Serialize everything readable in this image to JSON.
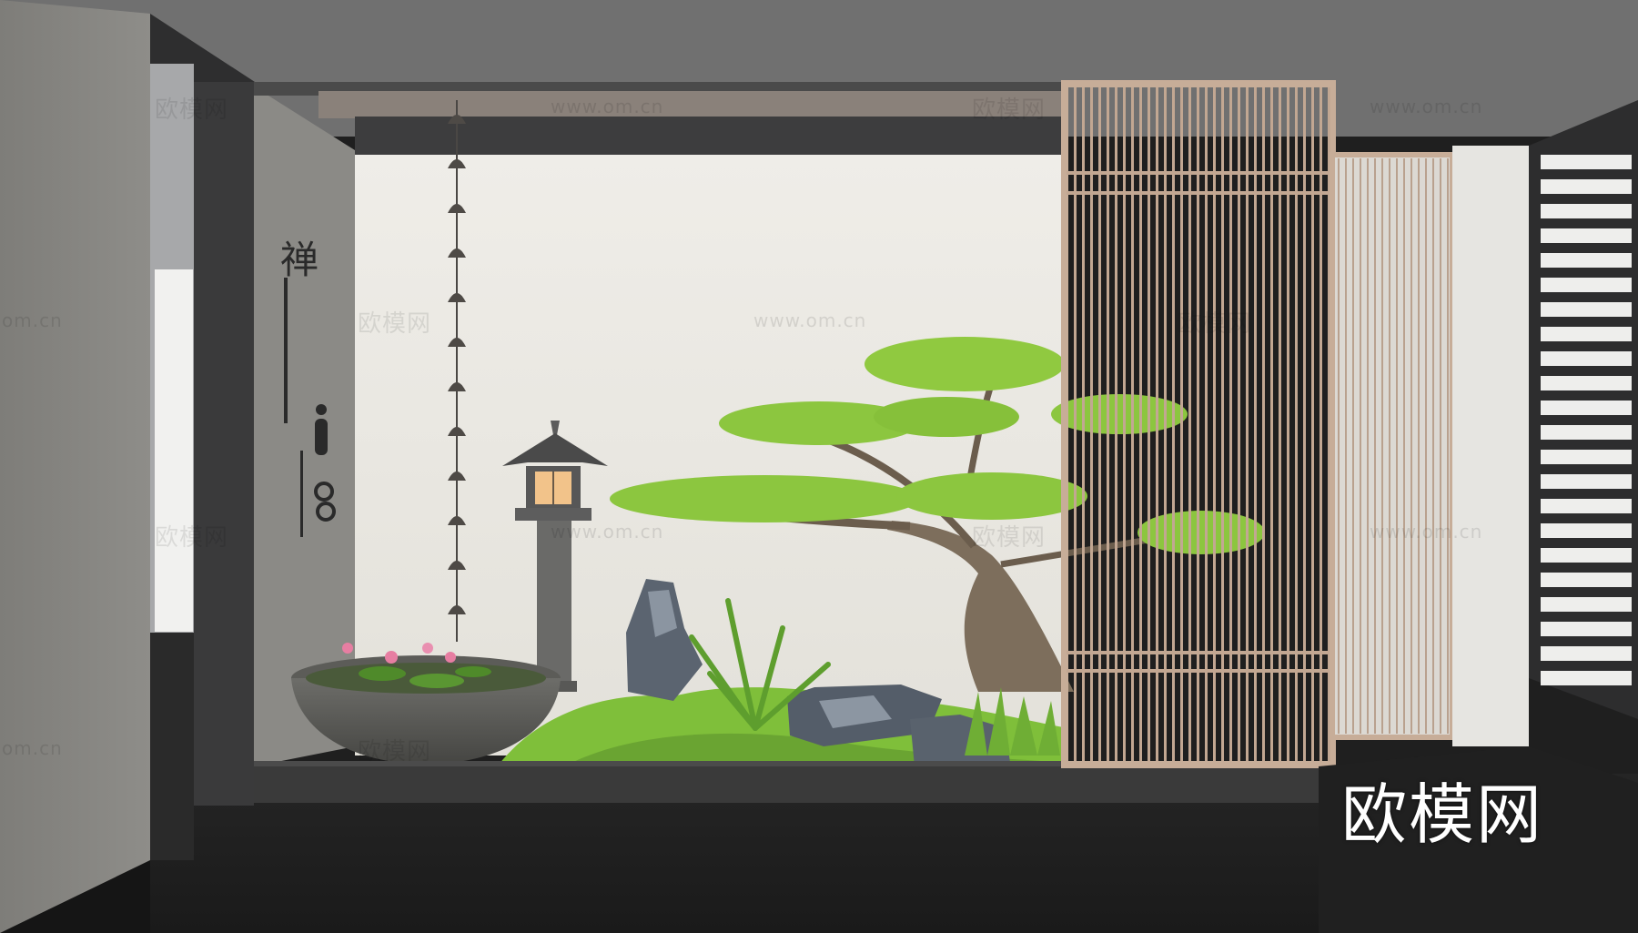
{
  "scene": {
    "description_free": true,
    "colors": {
      "ceiling": "#6f6f6f",
      "left_wall": "#8a8985",
      "back_wall": "#e9e7e1",
      "floor": "#1d1d1d",
      "dark_frame": "#3c3c3d",
      "wood_screen": "#c9b09c",
      "moss": "#7fbf3a",
      "pine_foliage": "#8cc63f",
      "rock": "#5b6470",
      "lantern_glow": "#f2c38a"
    }
  },
  "wall_art": {
    "calligraphy": "禅"
  },
  "watermarks": {
    "cn_text": "欧模网",
    "url_text": "www.om.cn",
    "partial_url": "om.cn",
    "logo_text": "欧模网"
  }
}
